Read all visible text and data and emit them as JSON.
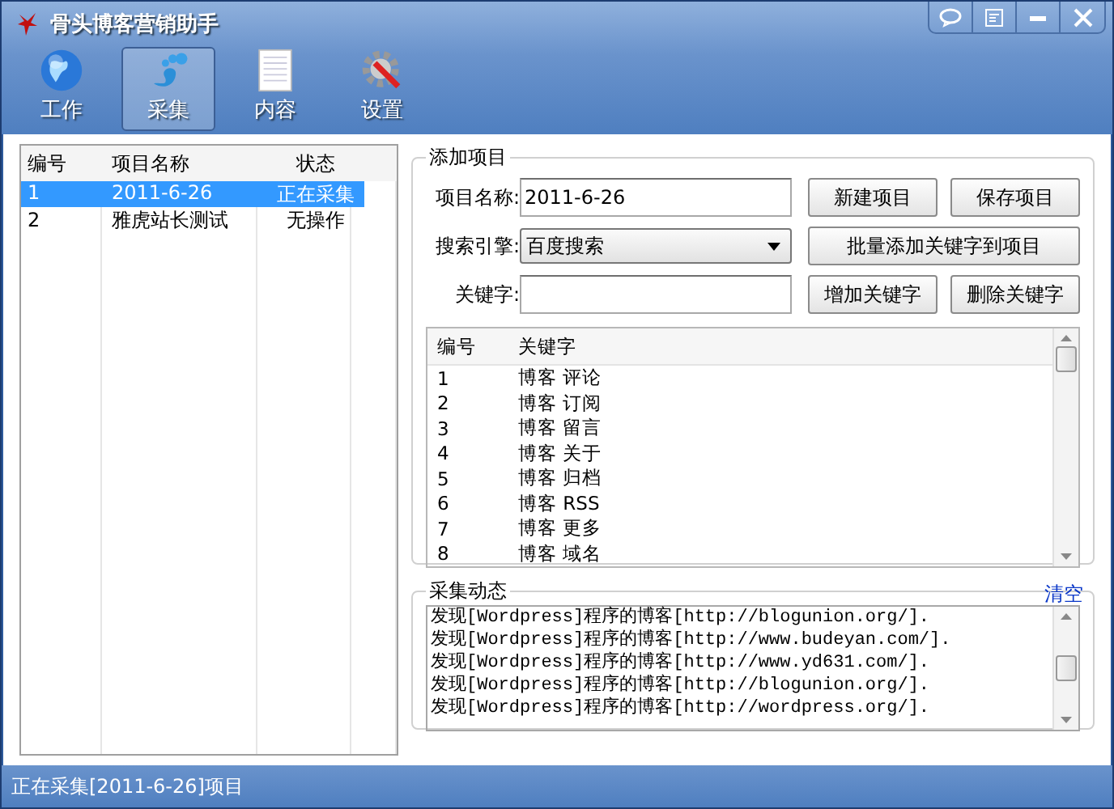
{
  "window": {
    "title": "骨头博客营销助手"
  },
  "toolbar": [
    {
      "label": "工作",
      "kind": "globe",
      "selected": false
    },
    {
      "label": "采集",
      "kind": "foot",
      "selected": true
    },
    {
      "label": "内容",
      "kind": "doc",
      "selected": false
    },
    {
      "label": "设置",
      "kind": "gear",
      "selected": false
    }
  ],
  "projects": {
    "columns": [
      "编号",
      "项目名称",
      "状态"
    ],
    "rows": [
      {
        "cells": [
          "1",
          "2011-6-26",
          "正在采集"
        ],
        "selected": true
      },
      {
        "cells": [
          "2",
          "雅虎站长测试",
          "无操作"
        ],
        "selected": false
      }
    ]
  },
  "add_project": {
    "title": "添加项目",
    "name_label": "项目名称:",
    "name_value": "2011-6-26",
    "engine_label": "搜索引擎:",
    "engine_value": "百度搜索",
    "keyword_label": "关键字:",
    "buttons": {
      "new": "新建项目",
      "save": "保存项目",
      "batch": "批量添加关键字到项目",
      "add": "增加关键字",
      "delete": "删除关键字"
    },
    "keywords": {
      "columns": [
        "编号",
        "关键字"
      ],
      "rows": [
        [
          "1",
          "博客 评论"
        ],
        [
          "2",
          "博客 订阅"
        ],
        [
          "3",
          "博客 留言"
        ],
        [
          "4",
          "博客 关于"
        ],
        [
          "5",
          "博客 归档"
        ],
        [
          "6",
          "博客 RSS"
        ],
        [
          "7",
          "博客 更多"
        ],
        [
          "8",
          "博客 域名"
        ]
      ]
    }
  },
  "log": {
    "title": "采集动态",
    "clear": "清空",
    "lines": [
      "发现[Wordpress]程序的博客[http://blogunion.org/].",
      "发现[Wordpress]程序的博客[http://www.budeyan.com/].",
      "发现[Wordpress]程序的博客[http://www.yd631.com/].",
      "发现[Wordpress]程序的博客[http://blogunion.org/].",
      "发现[Wordpress]程序的博客[http://wordpress.org/]."
    ]
  },
  "status_bar": "正在采集[2011-6-26]项目"
}
